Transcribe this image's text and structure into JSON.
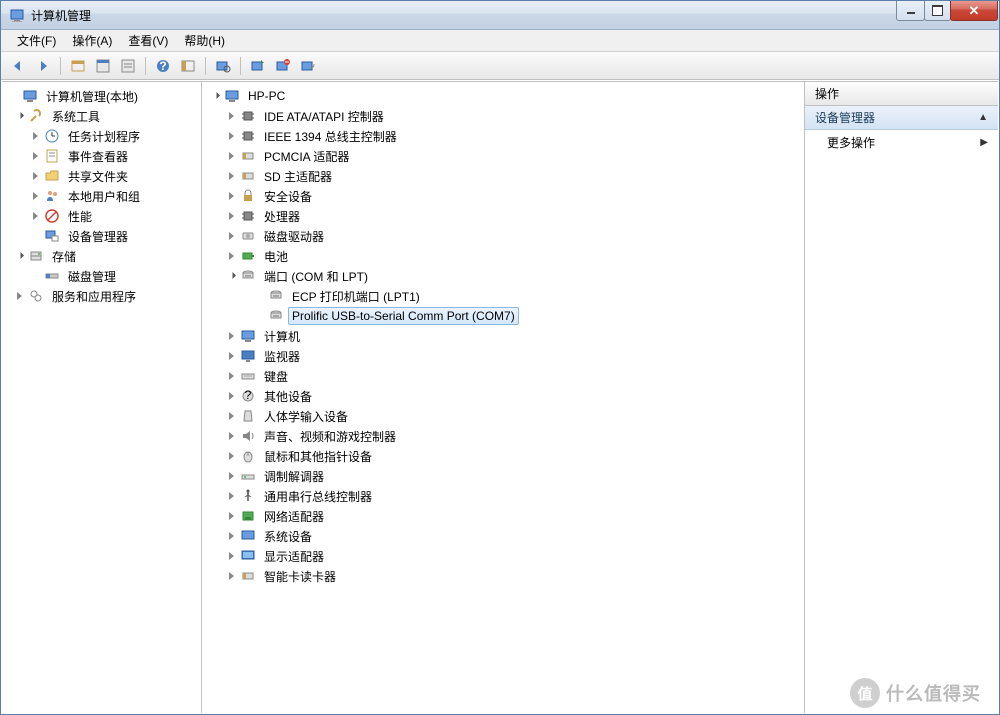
{
  "window": {
    "title": "计算机管理"
  },
  "menu": {
    "file": "文件(F)",
    "action": "操作(A)",
    "view": "查看(V)",
    "help": "帮助(H)"
  },
  "left_tree": {
    "root": "计算机管理(本地)",
    "system_tools": "系统工具",
    "task_scheduler": "任务计划程序",
    "event_viewer": "事件查看器",
    "shared_folders": "共享文件夹",
    "local_users": "本地用户和组",
    "performance": "性能",
    "device_manager": "设备管理器",
    "storage": "存储",
    "disk_management": "磁盘管理",
    "services_apps": "服务和应用程序"
  },
  "device_tree": {
    "root": "HP-PC",
    "categories": {
      "ide": "IDE ATA/ATAPI 控制器",
      "ieee1394": "IEEE 1394 总线主控制器",
      "pcmcia": "PCMCIA 适配器",
      "sd": "SD 主适配器",
      "security": "安全设备",
      "cpu": "处理器",
      "disk": "磁盘驱动器",
      "battery": "电池",
      "ports": "端口 (COM 和 LPT)",
      "port_ecp": "ECP 打印机端口 (LPT1)",
      "port_prolific": "Prolific USB-to-Serial Comm Port (COM7)",
      "computer": "计算机",
      "monitor": "监视器",
      "keyboard": "键盘",
      "other": "其他设备",
      "hid": "人体学输入设备",
      "sound": "声音、视频和游戏控制器",
      "mouse": "鼠标和其他指针设备",
      "modem": "调制解调器",
      "usb": "通用串行总线控制器",
      "network": "网络适配器",
      "system": "系统设备",
      "display": "显示适配器",
      "smartcard": "智能卡读卡器"
    }
  },
  "actions_pane": {
    "header": "操作",
    "section": "设备管理器",
    "more_actions": "更多操作"
  },
  "watermark": {
    "circle": "值",
    "text": "什么值得买"
  }
}
